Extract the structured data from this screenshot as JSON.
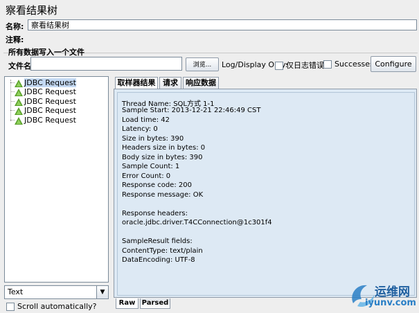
{
  "window": {
    "title": "察看结果树"
  },
  "form": {
    "name_label": "名称:",
    "name_value": "察看结果树",
    "comment_label": "注释:",
    "comment_value": ""
  },
  "file_group": {
    "title": "所有数据写入一个文件",
    "filename_label": "文件名",
    "filename_value": "",
    "browse_label": "浏览...",
    "log_display_label": "Log/Display Only:",
    "errors_label": "仅日志错误",
    "errors_checked": false,
    "successes_label": "Successes",
    "successes_checked": false,
    "configure_label": "Configure"
  },
  "tree": {
    "items": [
      {
        "label": "JDBC Request",
        "selected": true
      },
      {
        "label": "JDBC Request",
        "selected": false
      },
      {
        "label": "JDBC Request",
        "selected": false
      },
      {
        "label": "JDBC Request",
        "selected": false
      },
      {
        "label": "JDBC Request",
        "selected": false
      }
    ]
  },
  "renderer": {
    "selected": "Text"
  },
  "scroll": {
    "label": "Scroll automatically?",
    "checked": false
  },
  "tabs": [
    {
      "label": "取样器结果",
      "active": true
    },
    {
      "label": "请求",
      "active": false
    },
    {
      "label": "响应数据",
      "active": false
    }
  ],
  "result_lines": [
    "Thread Name: SQL方式 1-1",
    "Sample Start: 2013-12-21 22:46:49 CST",
    "Load time: 42",
    "Latency: 0",
    "Size in bytes: 390",
    "Headers size in bytes: 0",
    "Body size in bytes: 390",
    "Sample Count: 1",
    "Error Count: 0",
    "Response code: 200",
    "Response message: OK",
    "",
    "Response headers:",
    "oracle.jdbc.driver.T4CConnection@1c301f4",
    "",
    "SampleResult fields:",
    "ContentType: text/plain",
    "DataEncoding: UTF-8"
  ],
  "bottom_tabs": [
    {
      "label": "Raw",
      "active": true
    },
    {
      "label": "Parsed",
      "active": false
    }
  ],
  "watermark": {
    "line1": "运维网",
    "line2": "iyunv.com"
  },
  "colors": {
    "selection": "#c4d9f2",
    "panel_bg": "#dde9f4",
    "ok_icon": "#5aa02c"
  }
}
